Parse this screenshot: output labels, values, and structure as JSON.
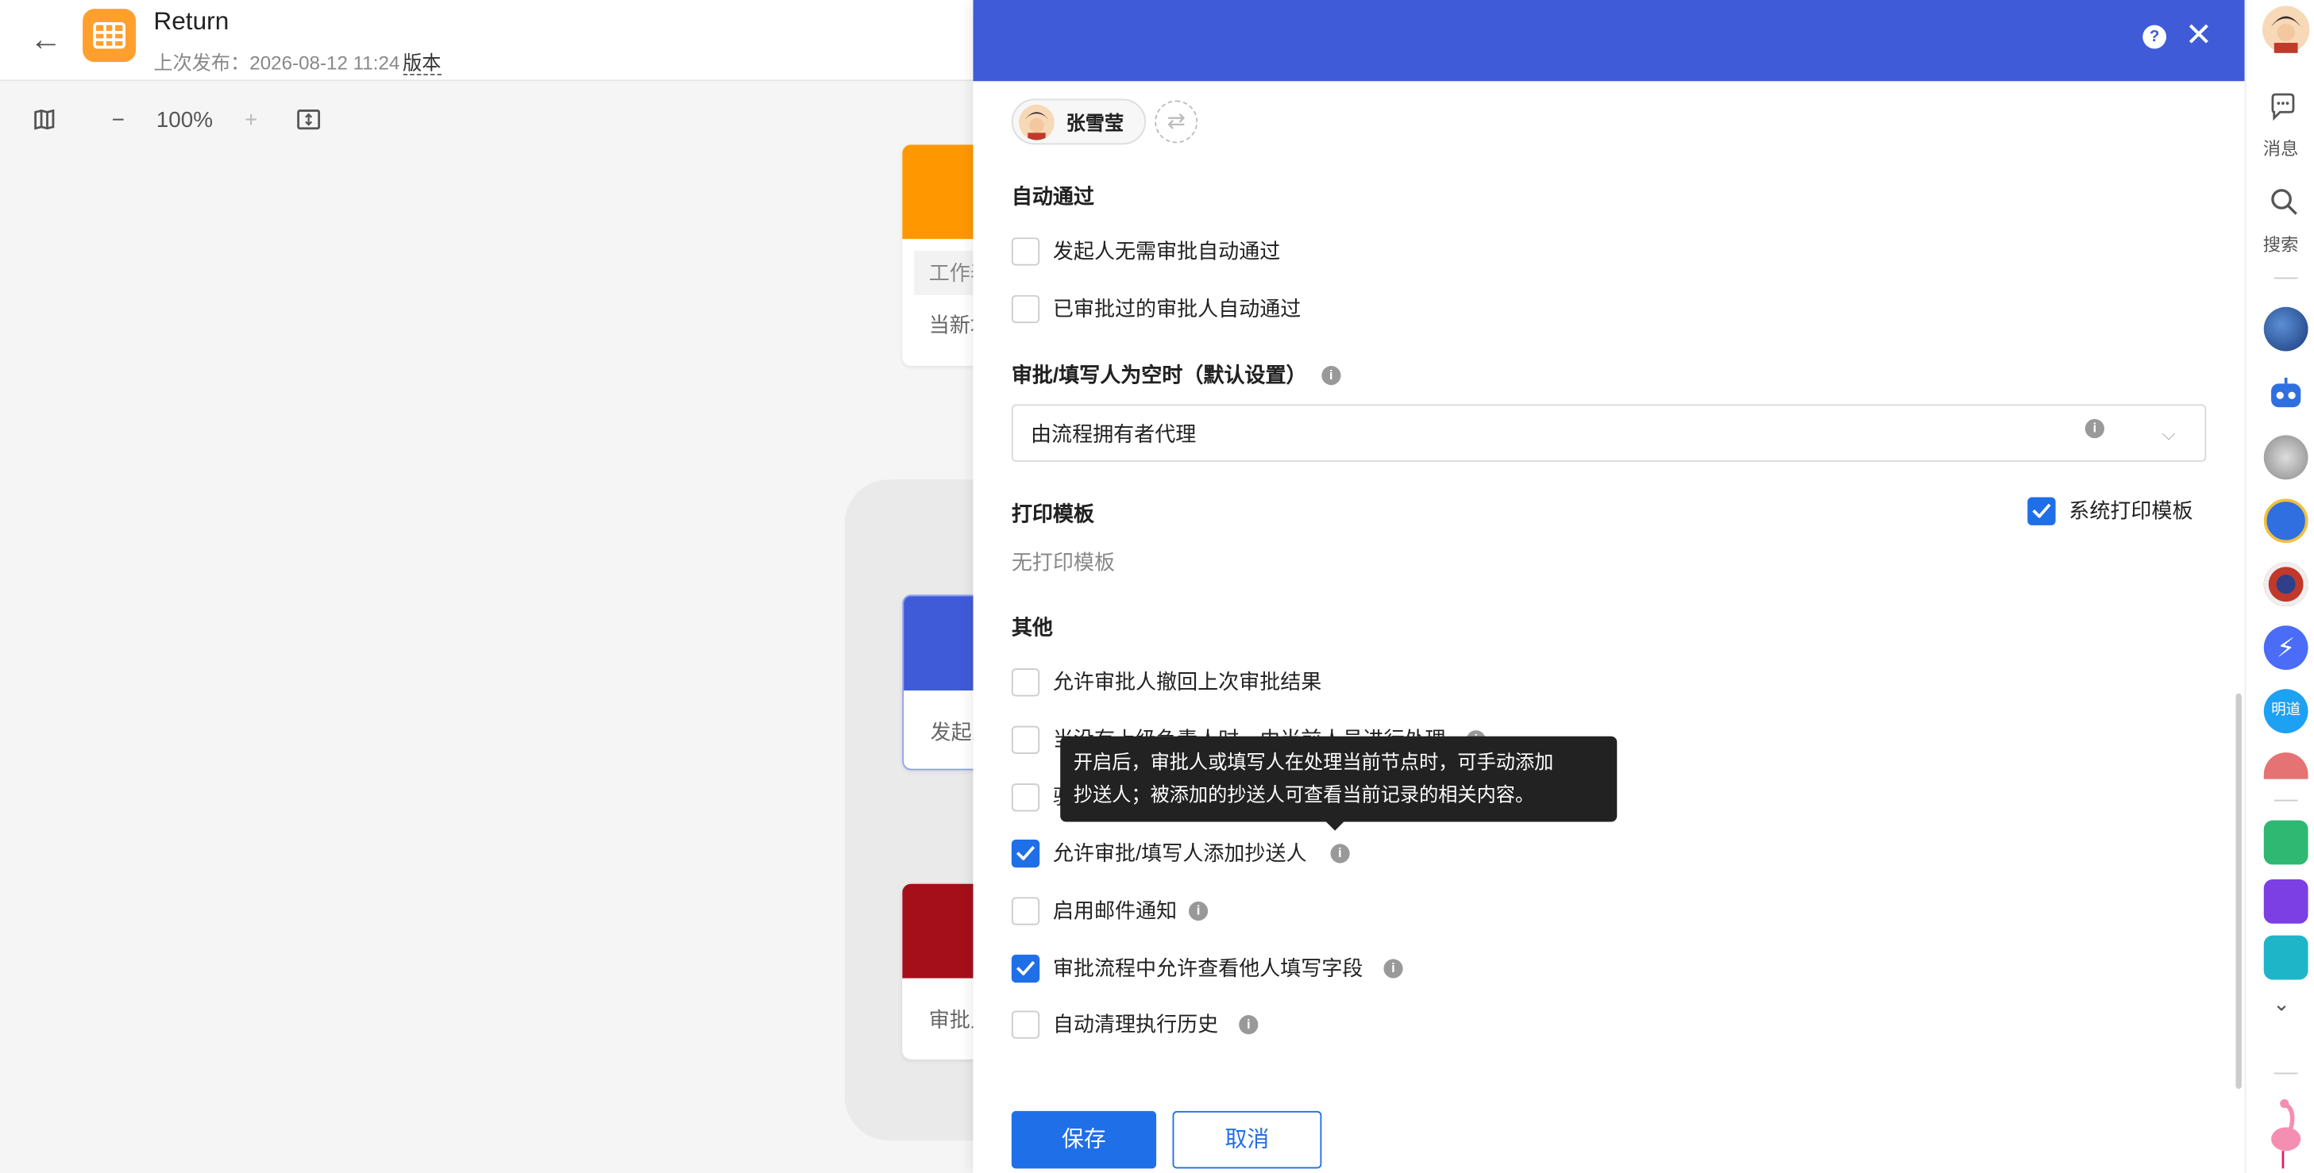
{
  "header": {
    "title": "Return",
    "publish_label": "上次发布：2026-08-12 11:24",
    "version_label": "版本"
  },
  "canvas_toolbar": {
    "zoom_level": "100%",
    "zoom_out": "−",
    "zoom_in": "+"
  },
  "canvas_nodes": [
    {
      "text": "工作表",
      "text2": "当新增",
      "color": "#ff9800"
    },
    {
      "text": "发起人",
      "color": "#3f5bd8"
    },
    {
      "text": "审批人",
      "color": "#a50f1a"
    }
  ],
  "drawer": {
    "header_color": "#3f5bd8",
    "help_label": "?",
    "close_label": "✕",
    "approver": {
      "name": "张雪莹"
    },
    "auto_pass": {
      "title": "自动通过",
      "options": [
        {
          "label": "发起人无需审批自动通过",
          "checked": false
        },
        {
          "label": "已审批过的审批人自动通过",
          "checked": false
        }
      ]
    },
    "empty_approver": {
      "title": "审批/填写人为空时（默认设置）",
      "select_value": "由流程拥有者代理"
    },
    "print": {
      "title": "打印模板",
      "system_template_label": "系统打印模板",
      "system_template_checked": true,
      "empty_text": "无打印模板"
    },
    "other": {
      "title": "其他",
      "options": [
        {
          "label": "允许审批人撤回上次审批结果",
          "checked": false
        },
        {
          "label": "当没有上级负责人时，由当前人员进行处理",
          "checked": false
        },
        {
          "label": "驳回",
          "checked": false
        },
        {
          "label": "允许审批/填写人添加抄送人",
          "checked": true
        },
        {
          "label": "启用邮件通知",
          "checked": false
        },
        {
          "label": "审批流程中允许查看他人填写字段",
          "checked": true
        },
        {
          "label": "自动清理执行历史",
          "checked": false
        }
      ]
    },
    "tooltip_line1": "开启后，审批人或填写人在处理当前节点时，可手动添加",
    "tooltip_line2": "抄送人；被添加的抄送人可查看当前记录的相关内容。",
    "save_label": "保存",
    "cancel_label": "取消"
  },
  "rail": {
    "messages_label": "消息",
    "search_label": "搜索",
    "apps": [
      "globe-icon",
      "robot-icon",
      "apple-icon",
      "character-icon",
      "shield-icon",
      "bolt-icon",
      "mingdao-icon",
      "avatar-icon",
      "stack-icon",
      "openai-icon",
      "handshake-icon"
    ],
    "mingdao_label": "明道"
  },
  "colors": {
    "primary": "#1f6fe8",
    "drawer_header": "#3f5bd8",
    "app_icon": "#ff9f2e"
  }
}
